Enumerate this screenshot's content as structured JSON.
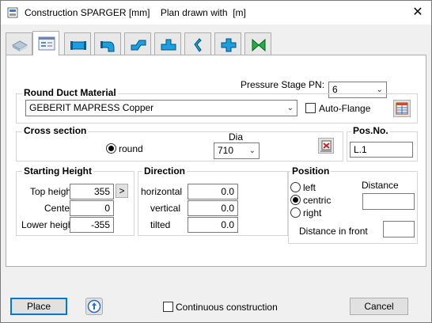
{
  "window": {
    "title": "Construction SPARGER [mm]    Plan drawn with  [m]",
    "close_glyph": "✕"
  },
  "tabs": [
    {
      "icon": "duct-3d-icon"
    },
    {
      "icon": "form-list-icon"
    },
    {
      "icon": "straight-duct-icon"
    },
    {
      "icon": "bend-duct-icon"
    },
    {
      "icon": "offset-duct-icon"
    },
    {
      "icon": "tee-duct-icon"
    },
    {
      "icon": "reducer-duct-icon"
    },
    {
      "icon": "cross-duct-icon"
    },
    {
      "icon": "valve-icon"
    }
  ],
  "pressure": {
    "label": "Pressure Stage PN:",
    "value": "6"
  },
  "material": {
    "group_label": "Round Duct Material",
    "value": "GEBERIT MAPRESS Copper",
    "auto_flange_label": "Auto-Flange"
  },
  "cross_section": {
    "group_label": "Cross section",
    "round_label": "round",
    "dia_label": "Dia",
    "dia_value": "710"
  },
  "pos_no": {
    "group_label": "Pos.No.",
    "value": "L.1"
  },
  "starting_height": {
    "group_label": "Starting Height",
    "top_label": "Top height",
    "top_value": "355",
    "arrow_label": ">",
    "center_label": "Center",
    "center_value": "0",
    "lower_label": "Lower height",
    "lower_value": "-355"
  },
  "direction": {
    "group_label": "Direction",
    "horizontal_label": "horizontal",
    "horizontal_value": "0.0",
    "vertical_label": "vertical",
    "vertical_value": "0.0",
    "tilted_label": "tilted",
    "tilted_value": "0.0"
  },
  "position": {
    "group_label": "Position",
    "left_label": "left",
    "centric_label": "centric",
    "right_label": "right",
    "distance_label": "Distance",
    "distance_value": "",
    "distance_front_label": "Distance in front",
    "distance_front_value": ""
  },
  "footer": {
    "place_label": "Place",
    "continuous_label": "Continuous construction",
    "cancel_label": "Cancel"
  }
}
